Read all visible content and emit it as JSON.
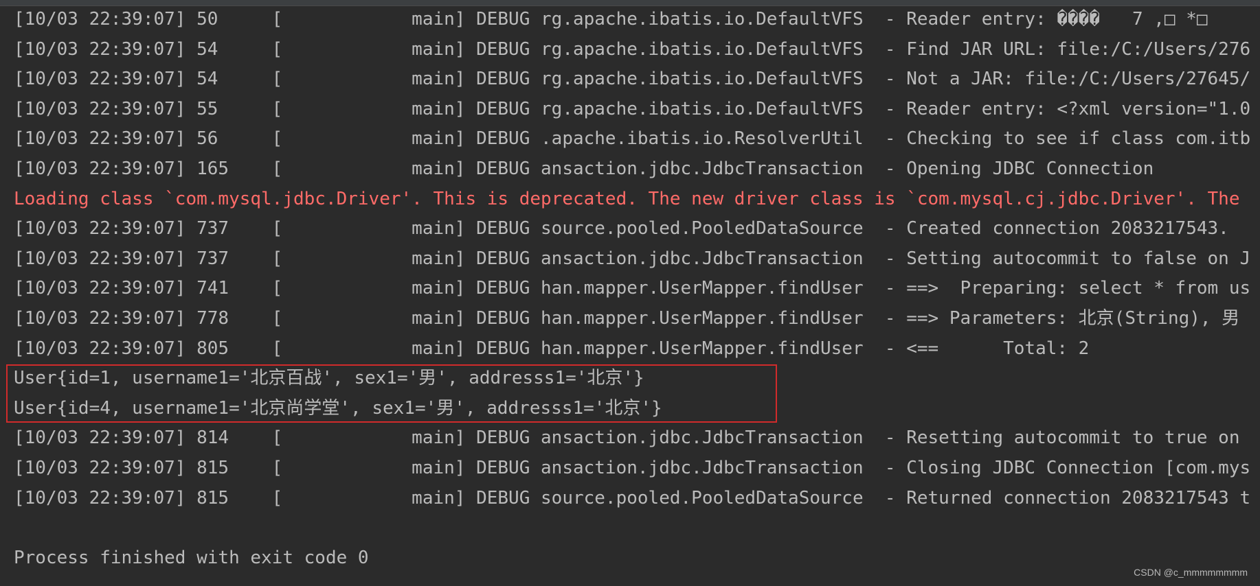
{
  "console": {
    "lines": [
      {
        "text": "[10/03 22:39:07] 50     [            main] DEBUG rg.apache.ibatis.io.DefaultVFS  - Reader entry: ����   7 ,□ *□",
        "type": "debug"
      },
      {
        "text": "[10/03 22:39:07] 54     [            main] DEBUG rg.apache.ibatis.io.DefaultVFS  - Find JAR URL: file:/C:/Users/276",
        "type": "debug"
      },
      {
        "text": "[10/03 22:39:07] 54     [            main] DEBUG rg.apache.ibatis.io.DefaultVFS  - Not a JAR: file:/C:/Users/27645/",
        "type": "debug"
      },
      {
        "text": "[10/03 22:39:07] 55     [            main] DEBUG rg.apache.ibatis.io.DefaultVFS  - Reader entry: <?xml version=\"1.0",
        "type": "debug"
      },
      {
        "text": "[10/03 22:39:07] 56     [            main] DEBUG .apache.ibatis.io.ResolverUtil  - Checking to see if class com.itb",
        "type": "debug"
      },
      {
        "text": "[10/03 22:39:07] 165    [            main] DEBUG ansaction.jdbc.JdbcTransaction  - Opening JDBC Connection",
        "type": "debug"
      },
      {
        "text": "Loading class `com.mysql.jdbc.Driver'. This is deprecated. The new driver class is `com.mysql.cj.jdbc.Driver'. The",
        "type": "error"
      },
      {
        "text": "[10/03 22:39:07] 737    [            main] DEBUG source.pooled.PooledDataSource  - Created connection 2083217543.",
        "type": "debug"
      },
      {
        "text": "[10/03 22:39:07] 737    [            main] DEBUG ansaction.jdbc.JdbcTransaction  - Setting autocommit to false on J",
        "type": "debug"
      },
      {
        "text": "[10/03 22:39:07] 741    [            main] DEBUG han.mapper.UserMapper.findUser  - ==>  Preparing: select * from us",
        "type": "debug"
      },
      {
        "text": "[10/03 22:39:07] 778    [            main] DEBUG han.mapper.UserMapper.findUser  - ==> Parameters: 北京(String), 男",
        "type": "debug"
      },
      {
        "text": "[10/03 22:39:07] 805    [            main] DEBUG han.mapper.UserMapper.findUser  - <==      Total: 2",
        "type": "debug"
      },
      {
        "text": "User{id=1, username1='北京百战', sex1='男', addresss1='北京'}",
        "type": "output"
      },
      {
        "text": "User{id=4, username1='北京尚学堂', sex1='男', addresss1='北京'}",
        "type": "output"
      },
      {
        "text": "[10/03 22:39:07] 814    [            main] DEBUG ansaction.jdbc.JdbcTransaction  - Resetting autocommit to true on ",
        "type": "debug"
      },
      {
        "text": "[10/03 22:39:07] 815    [            main] DEBUG ansaction.jdbc.JdbcTransaction  - Closing JDBC Connection [com.mys",
        "type": "debug"
      },
      {
        "text": "[10/03 22:39:07] 815    [            main] DEBUG source.pooled.PooledDataSource  - Returned connection 2083217543 t",
        "type": "debug"
      },
      {
        "text": "",
        "type": "blank"
      },
      {
        "text": "Process finished with exit code 0",
        "type": "output"
      }
    ]
  },
  "watermark": {
    "text": "CSDN @c_mmmmmmmm"
  },
  "colors": {
    "background": "#2b2b2b",
    "text": "#bbbbbb",
    "error": "#ff6b68",
    "highlight_border": "#d12b2b"
  }
}
